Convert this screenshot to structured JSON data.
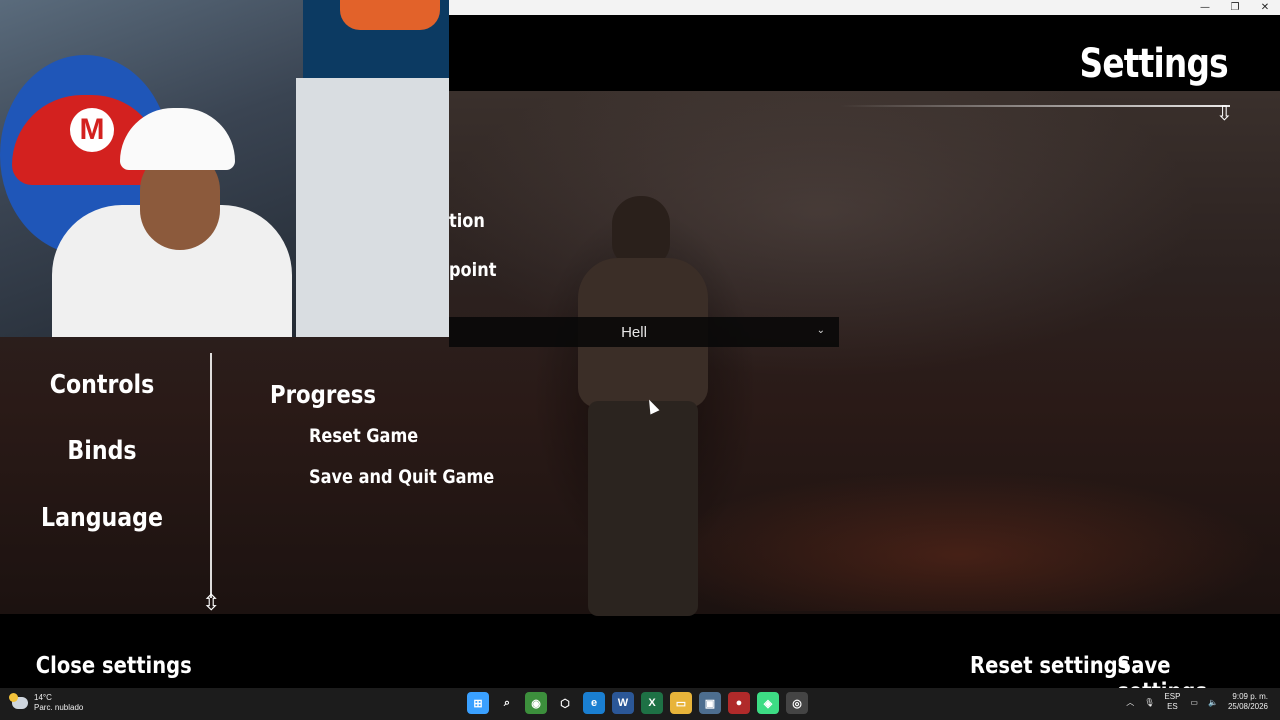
{
  "window": {
    "minimize_icon": "minimize-icon",
    "maximize_icon": "restore-icon",
    "close_icon": "close-icon"
  },
  "settings": {
    "title": "Settings",
    "partial_labels": [
      "tion",
      "point"
    ],
    "difficulty_value": "Hell"
  },
  "sidebar": {
    "items": [
      {
        "label": "Controls"
      },
      {
        "label": "Binds"
      },
      {
        "label": "Language"
      }
    ]
  },
  "progress": {
    "title": "Progress",
    "actions": [
      {
        "label": "Reset Game"
      },
      {
        "label": "Save and Quit Game"
      }
    ]
  },
  "footer": {
    "close_label": "Close settings",
    "reset_label": "Reset settings",
    "save_label": "Save settings"
  },
  "taskbar": {
    "weather_temp": "14°C",
    "weather_desc": "Parc. nublado",
    "apps": [
      {
        "name": "windows-start-icon",
        "color": "#3aa0ff",
        "glyph": "⊞"
      },
      {
        "name": "search-icon",
        "color": "transparent",
        "glyph": "⌕"
      },
      {
        "name": "chrome-icon",
        "color": "#3c8f3c",
        "glyph": "◉"
      },
      {
        "name": "unity-icon",
        "color": "transparent",
        "glyph": "⬡"
      },
      {
        "name": "edge-icon",
        "color": "#1a7fd1",
        "glyph": "e"
      },
      {
        "name": "word-icon",
        "color": "#2b5797",
        "glyph": "W"
      },
      {
        "name": "excel-icon",
        "color": "#1e7145",
        "glyph": "X"
      },
      {
        "name": "file-explorer-icon",
        "color": "#e8b43a",
        "glyph": "▭"
      },
      {
        "name": "task-view-icon",
        "color": "#4d6e8f",
        "glyph": "▣"
      },
      {
        "name": "game-app-icon",
        "color": "#b02a2a",
        "glyph": "●"
      },
      {
        "name": "android-studio-icon",
        "color": "#3ddc84",
        "glyph": "◈"
      },
      {
        "name": "obs-icon",
        "color": "#444444",
        "glyph": "◎"
      }
    ],
    "lang_top": "ESP",
    "lang_bottom": "ES",
    "time": "9:09 p. m.",
    "date": "25/08/2026"
  }
}
